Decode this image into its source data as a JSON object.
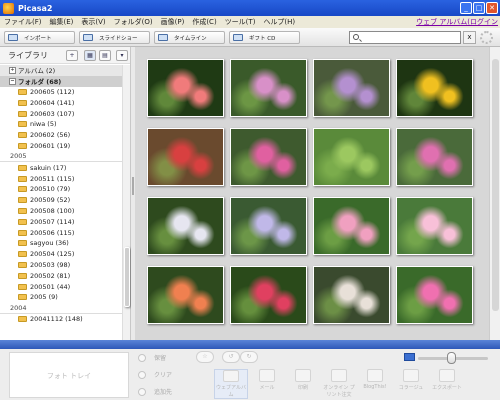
{
  "window": {
    "title": "Picasa2",
    "controls": [
      "_",
      "□",
      "✕"
    ]
  },
  "menu": {
    "items": [
      "ファイル(F)",
      "編集(E)",
      "表示(V)",
      "フォルダ(O)",
      "画像(P)",
      "作成(C)",
      "ツール(T)",
      "ヘルプ(H)"
    ],
    "right_link": "ウェブ アルバム(ログイン"
  },
  "toolbar": {
    "import": "インポート",
    "slideshow": "スライドショー",
    "timeline": "タイムライン",
    "gift_cd": "ギフト CD",
    "search_placeholder": "",
    "clear": "x"
  },
  "library": {
    "title": "ライブラリ",
    "view_icons": [
      "+",
      "▦",
      "▤",
      "▾"
    ],
    "groups": [
      {
        "label": "アルバム (2)",
        "state": "+"
      },
      {
        "label": "フォルダ (68)",
        "state": "−",
        "selected": true
      }
    ],
    "sections": [
      {
        "year": "",
        "folders": [
          "200605 (112)",
          "200604 (141)",
          "200603 (107)",
          "niwa (5)",
          "200602 (56)",
          "200601 (19)"
        ]
      },
      {
        "year": "2005",
        "folders": [
          "sakuin (17)",
          "200511 (115)",
          "200510 (79)",
          "200509 (52)",
          "200508 (100)",
          "200507 (114)",
          "200506 (115)",
          "sagyou (36)",
          "200504 (125)",
          "200503 (98)",
          "200502 (81)",
          "200501 (44)",
          "2005 (9)"
        ]
      },
      {
        "year": "2004",
        "folders": [
          "20041112 (148)"
        ]
      }
    ]
  },
  "photos": {
    "rows": 4,
    "cols": 4,
    "items": [
      {
        "subject": "pink-rose",
        "bg": "#1f3a14",
        "fg": "#f07b7b"
      },
      {
        "subject": "pink-hydrangea",
        "bg": "#3a5a2a",
        "fg": "#d890c8"
      },
      {
        "subject": "purple-hydrangea",
        "bg": "#4a5a3a",
        "fg": "#b490d0"
      },
      {
        "subject": "yellow-lily",
        "bg": "#1e3512",
        "fg": "#f0c020"
      },
      {
        "subject": "potted-red-flowers",
        "bg": "#6a4a2e",
        "fg": "#d84040"
      },
      {
        "subject": "garden-flowers",
        "bg": "#3e5a2e",
        "fg": "#e060a0"
      },
      {
        "subject": "green-leaves",
        "bg": "#5a8a3a",
        "fg": "#9cc860"
      },
      {
        "subject": "pink-lily-pots",
        "bg": "#4a6a3a",
        "fg": "#e070b0"
      },
      {
        "subject": "white-hydrangea",
        "bg": "#2e4a1e",
        "fg": "#e6e6f0"
      },
      {
        "subject": "blue-hydrangea",
        "bg": "#3a5a32",
        "fg": "#c0b8e8"
      },
      {
        "subject": "pink-blossom",
        "bg": "#3a6a2a",
        "fg": "#f0a0c0"
      },
      {
        "subject": "pink-flower-closeup",
        "bg": "#4a7a3a",
        "fg": "#f8c0d8"
      },
      {
        "subject": "orange-flowers",
        "bg": "#2e4a1e",
        "fg": "#f08050"
      },
      {
        "subject": "red-flowers-bush",
        "bg": "#2a4a1a",
        "fg": "#e04060"
      },
      {
        "subject": "white-bag-on-plant",
        "bg": "#3a4a2e",
        "fg": "#e8e0d8"
      },
      {
        "subject": "pink-dianthus",
        "bg": "#3a6a2a",
        "fg": "#f070b0"
      }
    ]
  },
  "tray": {
    "photo_tray_label": "フォト トレイ",
    "buttons": [
      "保留",
      "クリア",
      "追加先"
    ],
    "actions": [
      {
        "label": "ウェブアルバム",
        "selected": true
      },
      {
        "label": "メール"
      },
      {
        "label": "印刷"
      },
      {
        "label": "オンライン プリント注文"
      },
      {
        "label": "BlogThis!"
      },
      {
        "label": "コラージュ"
      },
      {
        "label": "エクスポート"
      }
    ]
  },
  "colors": {
    "titlebar": "#1c52d0",
    "menubar": "#ece9d8",
    "grid_bg": "#d7d7d7",
    "strip": "#3a66c4"
  }
}
